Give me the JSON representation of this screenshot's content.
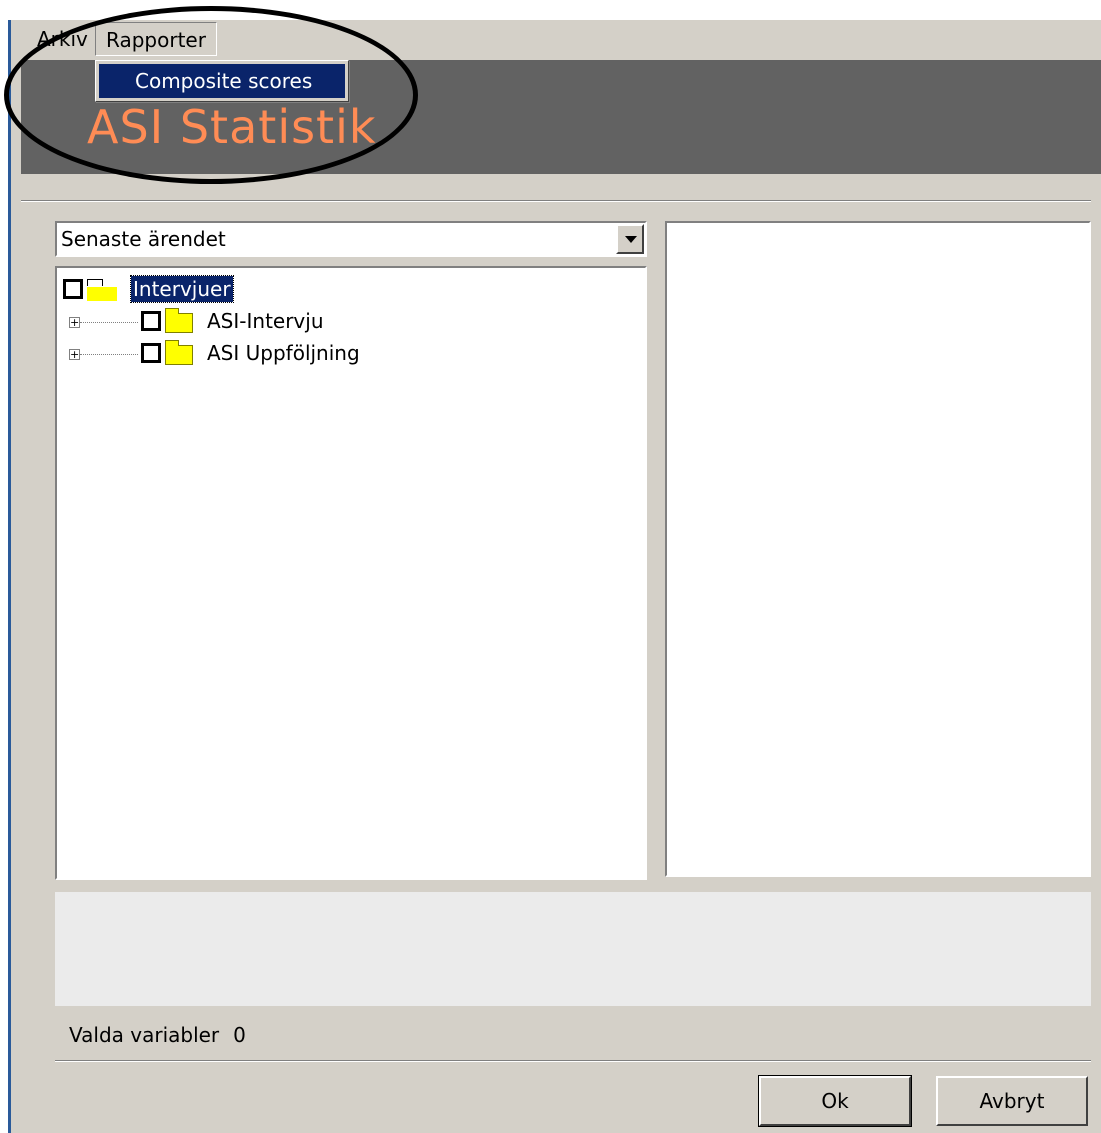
{
  "menubar": {
    "items": [
      {
        "label": "Arkiv"
      },
      {
        "label": "Rapporter"
      }
    ]
  },
  "menu_popup": {
    "items": [
      {
        "label": "Composite scores",
        "highlighted": true
      }
    ]
  },
  "banner": {
    "title": "ASI Statistik",
    "title_color": "#ff8c55",
    "background": "#626262"
  },
  "combo": {
    "value": "Senaste ärendet"
  },
  "tree": {
    "root": {
      "label": "Intervjuer",
      "selected": true,
      "checked": false
    },
    "children": [
      {
        "label": "ASI-Intervju",
        "checked": false,
        "expandable": true
      },
      {
        "label": "ASI Uppföljning",
        "checked": false,
        "expandable": true
      }
    ]
  },
  "status": {
    "label": "Valda variabler",
    "count": "0"
  },
  "buttons": {
    "ok": "Ok",
    "cancel": "Avbryt"
  },
  "colors": {
    "selection": "#0a246a",
    "window_bg": "#d4d0c8"
  }
}
